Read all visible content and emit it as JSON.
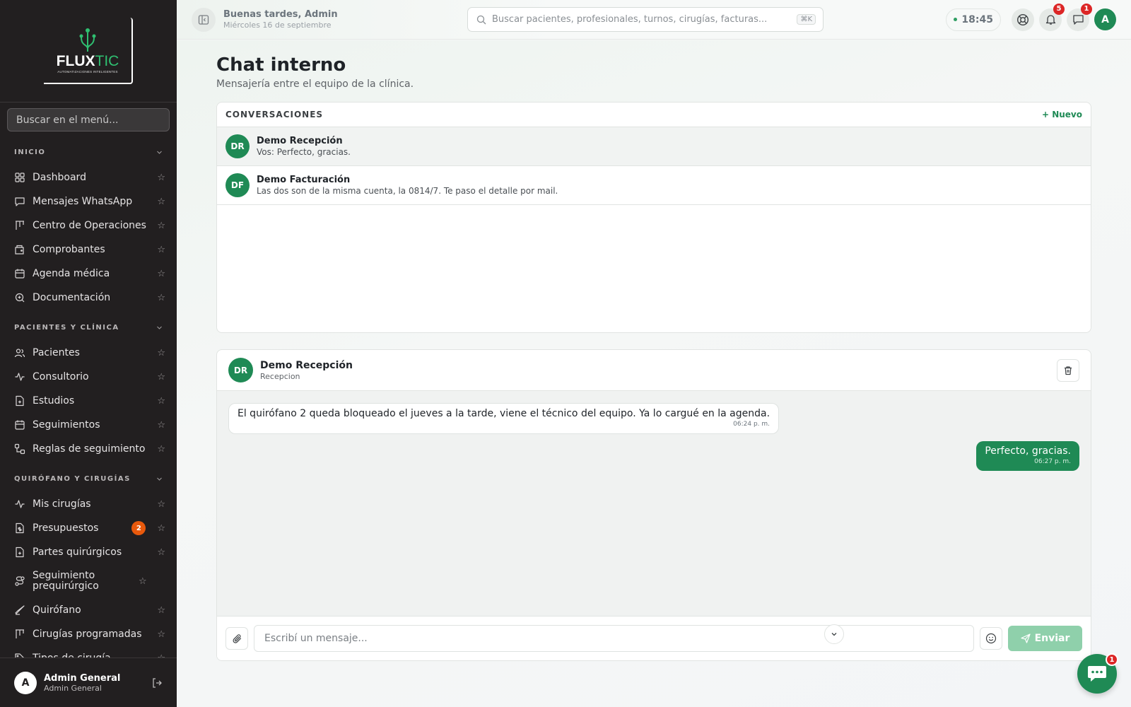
{
  "brand": {
    "logo_main": "FLUX",
    "logo_accent": "TIC",
    "logo_sub": "AUTOMATIZACIONES INTELIGENTES",
    "accent_color": "#1f8a55"
  },
  "sidebar": {
    "search_placeholder": "Buscar en el menú...",
    "sections": [
      {
        "title": "INICIO",
        "items": [
          {
            "label": "Dashboard",
            "icon": "dashboard-icon"
          },
          {
            "label": "Mensajes WhatsApp",
            "icon": "message-square-icon"
          },
          {
            "label": "Centro de Operaciones",
            "icon": "kanban-icon"
          },
          {
            "label": "Comprobantes",
            "icon": "wallet-icon"
          },
          {
            "label": "Agenda médica",
            "icon": "calendar-icon"
          },
          {
            "label": "Documentación",
            "icon": "search-doc-icon"
          }
        ]
      },
      {
        "title": "PACIENTES Y CLÍNICA",
        "items": [
          {
            "label": "Pacientes",
            "icon": "users-icon"
          },
          {
            "label": "Consultorio",
            "icon": "activity-icon"
          },
          {
            "label": "Estudios",
            "icon": "file-plus-icon"
          },
          {
            "label": "Seguimientos",
            "icon": "calendar-icon"
          },
          {
            "label": "Reglas de seguimiento",
            "icon": "workflow-icon"
          }
        ]
      },
      {
        "title": "QUIRÓFANO Y CIRUGÍAS",
        "items": [
          {
            "label": "Mis cirugías",
            "icon": "activity-icon"
          },
          {
            "label": "Presupuestos",
            "icon": "file-dollar-icon",
            "badge": "2"
          },
          {
            "label": "Partes quirúrgicos",
            "icon": "file-plus-icon"
          },
          {
            "label": "Seguimiento prequirúrgico",
            "icon": "route-icon"
          },
          {
            "label": "Quirófano",
            "icon": "scalpel-icon"
          },
          {
            "label": "Cirugías programadas",
            "icon": "kanban-icon"
          },
          {
            "label": "Tipos de cirugía",
            "icon": "tag-icon"
          }
        ]
      }
    ],
    "user": {
      "initial": "A",
      "name": "Admin General",
      "role": "Admin General"
    }
  },
  "topbar": {
    "greeting": "Buenas tardes, Admin",
    "date": "Miércoles 16 de septiembre",
    "search_placeholder": "Buscar pacientes, profesionales, turnos, cirugías, facturas...",
    "shortcut": "⌘K",
    "clock": "18:45",
    "notifications_count": "5",
    "messages_count": "1",
    "avatar_initial": "A"
  },
  "page": {
    "title": "Chat interno",
    "subtitle": "Mensajería entre el equipo de la clínica."
  },
  "conversations": {
    "header": "CONVERSACIONES",
    "new_label": "+ Nuevo",
    "items": [
      {
        "initials": "DR",
        "name": "Demo Recepción",
        "preview": "Vos: Perfecto, gracias."
      },
      {
        "initials": "DF",
        "name": "Demo Facturación",
        "preview": "Las dos son de la misma cuenta, la 0814/7. Te paso el detalle por mail."
      }
    ]
  },
  "chat": {
    "initials": "DR",
    "name": "Demo Recepción",
    "role": "Recepcion",
    "messages": [
      {
        "direction": "in",
        "text": "El quirófano 2 queda bloqueado el jueves a la tarde, viene el técnico del equipo. Ya lo cargué en la agenda.",
        "time": "06:24 p. m."
      },
      {
        "direction": "out",
        "text": "Perfecto, gracias.",
        "time": "06:27 p. m."
      }
    ],
    "input_placeholder": "Escribí un mensaje...",
    "send_label": "Enviar"
  },
  "fab": {
    "badge": "1"
  }
}
